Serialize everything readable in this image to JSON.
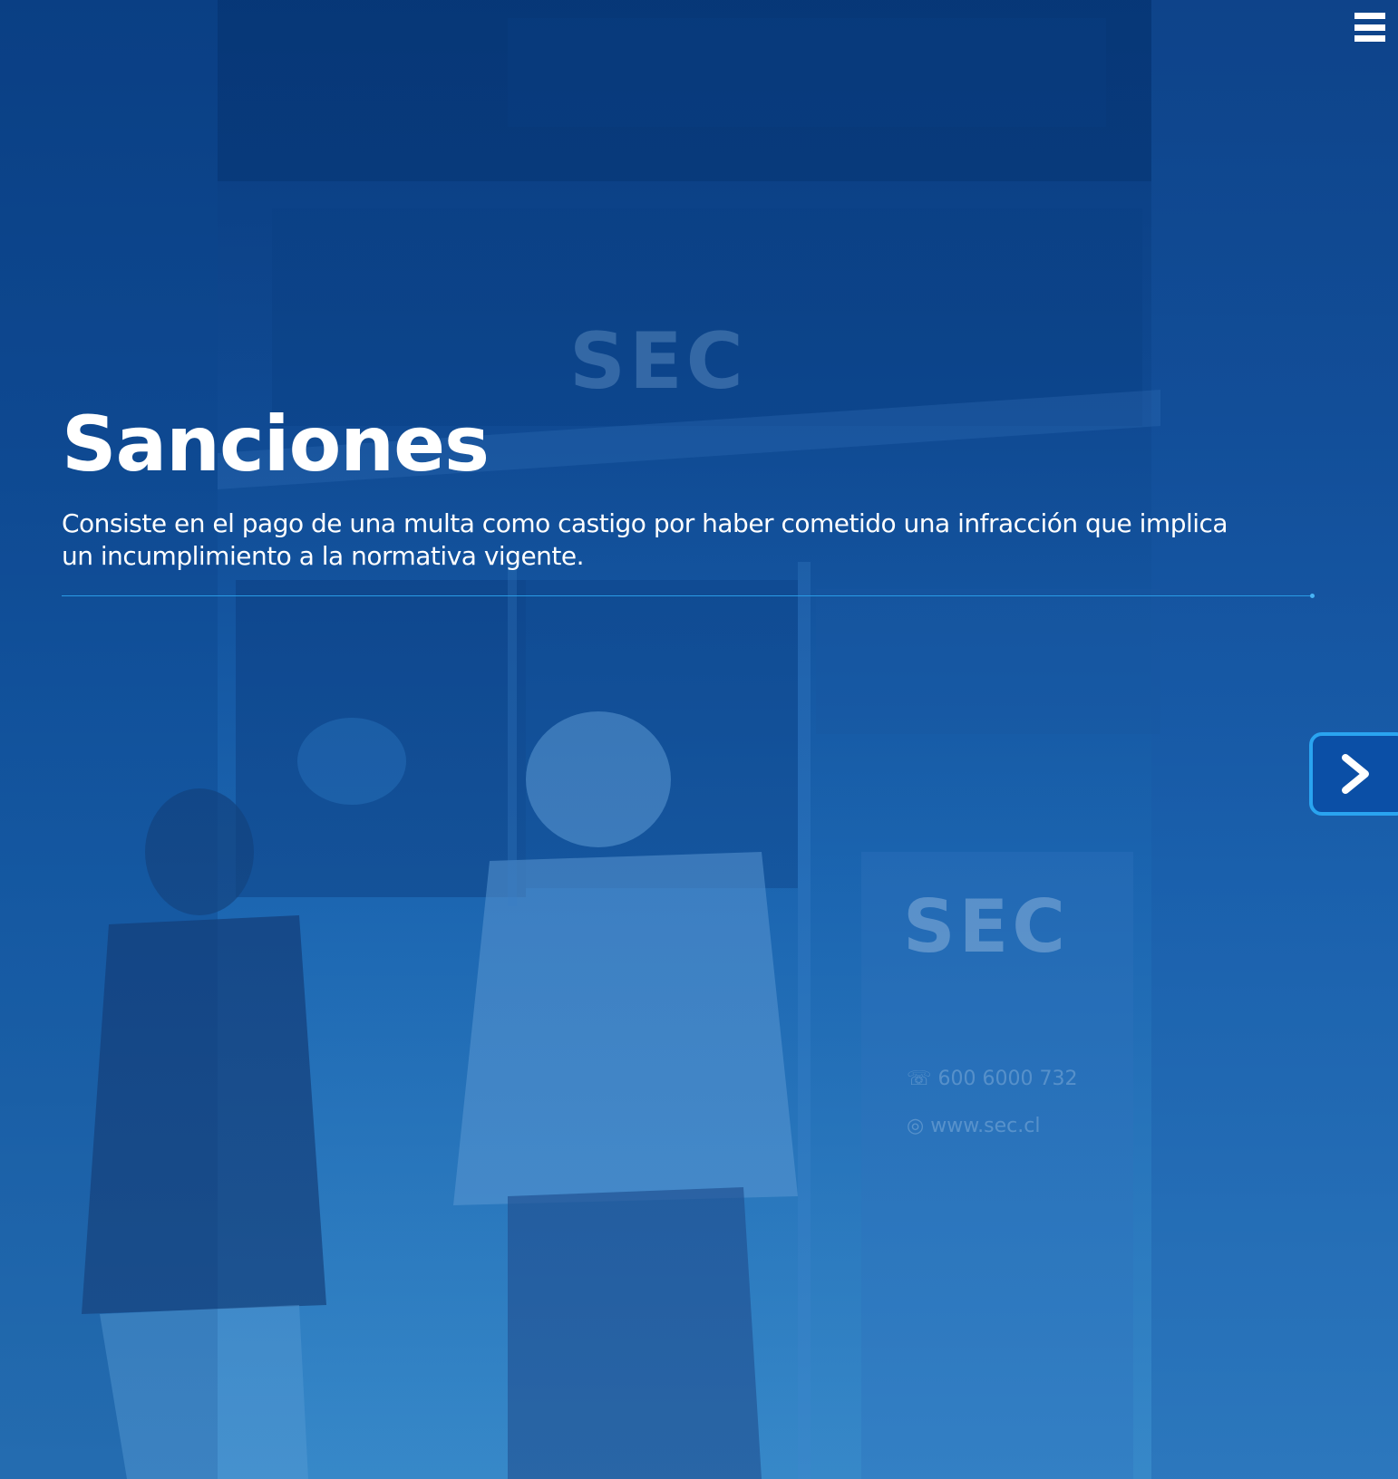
{
  "header": {
    "menu_icon": "hamburger-menu-icon"
  },
  "hero": {
    "title": "Sanciones",
    "description": "Consiste en el pago de una multa como castigo por haber cometido una infracción que implica un incumplimiento a la normativa vigente.",
    "background_logo_text": "SEC",
    "banner_logo_text": "SEC",
    "banner_phone": "600 6000 732",
    "banner_web": "www.sec.cl"
  },
  "navigation": {
    "next_icon": "chevron-right-icon"
  },
  "colors": {
    "overlay_top": "#0b3f82",
    "overlay_bottom": "#3686c6",
    "accent_line": "#2a9be6",
    "button_border": "#2aa4f0",
    "button_fill": "#0b4fa6",
    "text": "#ffffff"
  }
}
